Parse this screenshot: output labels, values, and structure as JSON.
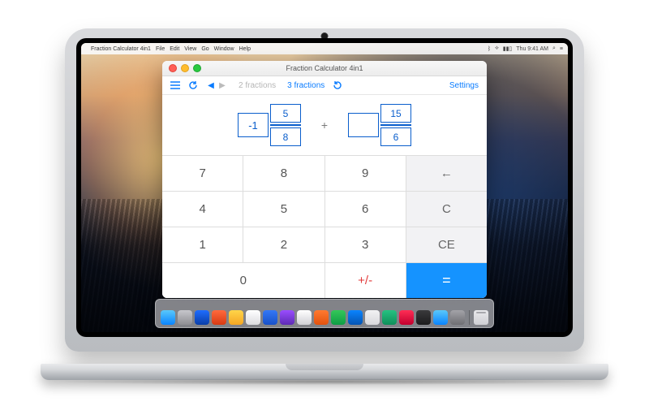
{
  "menubar": {
    "app_name": "Fraction Calculator 4in1",
    "items": [
      "File",
      "Edit",
      "View",
      "Go",
      "Window",
      "Help"
    ],
    "clock": "Thu 9:41 AM"
  },
  "window": {
    "title": "Fraction Calculator 4in1"
  },
  "toolbar": {
    "mode_2": "2 fractions",
    "mode_3": "3 fractions",
    "settings": "Settings"
  },
  "expression": {
    "left": {
      "whole": "-1",
      "num": "5",
      "den": "8"
    },
    "op": "+",
    "right": {
      "whole": "",
      "num": "15",
      "den": "6"
    }
  },
  "keypad": {
    "k7": "7",
    "k8": "8",
    "k9": "9",
    "back": "←",
    "k4": "4",
    "k5": "5",
    "k6": "6",
    "clear": "C",
    "k1": "1",
    "k2": "2",
    "k3": "3",
    "clear_entry": "CE",
    "k0": "0",
    "plus_minus": "+/-",
    "equals": "="
  },
  "dock_colors": [
    "linear-gradient(180deg,#5ac8fa,#0a84ff)",
    "linear-gradient(180deg,#c7c7cc,#8e8e93)",
    "linear-gradient(180deg,#1f6dff,#0b3ea8)",
    "linear-gradient(180deg,#ff6a3d,#d83a13)",
    "linear-gradient(180deg,#ffd54a,#f5a623)",
    "linear-gradient(180deg,#ffffff,#dcdce0)",
    "linear-gradient(180deg,#3478f6,#1851c9)",
    "linear-gradient(180deg,#9a4dff,#5d2bb5)",
    "linear-gradient(180deg,#ffffff,#d0d0d5)",
    "linear-gradient(180deg,#ff7a30,#e3520f)",
    "linear-gradient(180deg,#34c759,#0f9d45)",
    "linear-gradient(180deg,#0a84ff,#0554b3)",
    "linear-gradient(180deg,#f2f2f4,#d8d8dc)",
    "linear-gradient(180deg,#26c281,#0f8f5a)",
    "linear-gradient(180deg,#ff2d55,#c2002f)",
    "linear-gradient(180deg,#3a3a3c,#1c1c1e)",
    "linear-gradient(180deg,#5ac8fa,#0a84ff)",
    "linear-gradient(180deg,#a3a3a8,#6e6e73)"
  ]
}
